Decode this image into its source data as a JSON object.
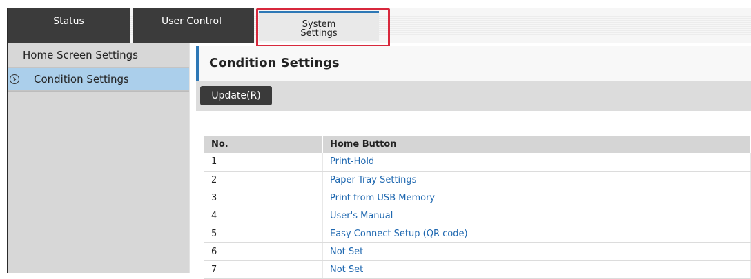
{
  "tabs": [
    {
      "label": "Status"
    },
    {
      "label": "User Control"
    },
    {
      "label": "System Settings",
      "label_lines": [
        "System",
        "Settings"
      ]
    }
  ],
  "sidebar": {
    "items": [
      {
        "label": "Home Screen Settings"
      },
      {
        "label": "Condition Settings",
        "active": true
      }
    ]
  },
  "main": {
    "title": "Condition Settings",
    "update_button": "Update(R)"
  },
  "table": {
    "headers": [
      "No.",
      "Home Button"
    ],
    "rows": [
      {
        "no": "1",
        "button": "Print-Hold"
      },
      {
        "no": "2",
        "button": "Paper Tray Settings"
      },
      {
        "no": "3",
        "button": "Print from USB Memory"
      },
      {
        "no": "4",
        "button": "User's Manual"
      },
      {
        "no": "5",
        "button": "Easy Connect Setup (QR code)"
      },
      {
        "no": "6",
        "button": "Not Set"
      },
      {
        "no": "7",
        "button": "Not Set"
      }
    ]
  },
  "colors": {
    "accent": "#2e78b6",
    "highlight": "#d8283c",
    "link": "#1f68b0",
    "sidebar_active": "#abcfeb"
  },
  "icons": {
    "sidebar_active_marker": "chevron-right-circle-icon"
  }
}
